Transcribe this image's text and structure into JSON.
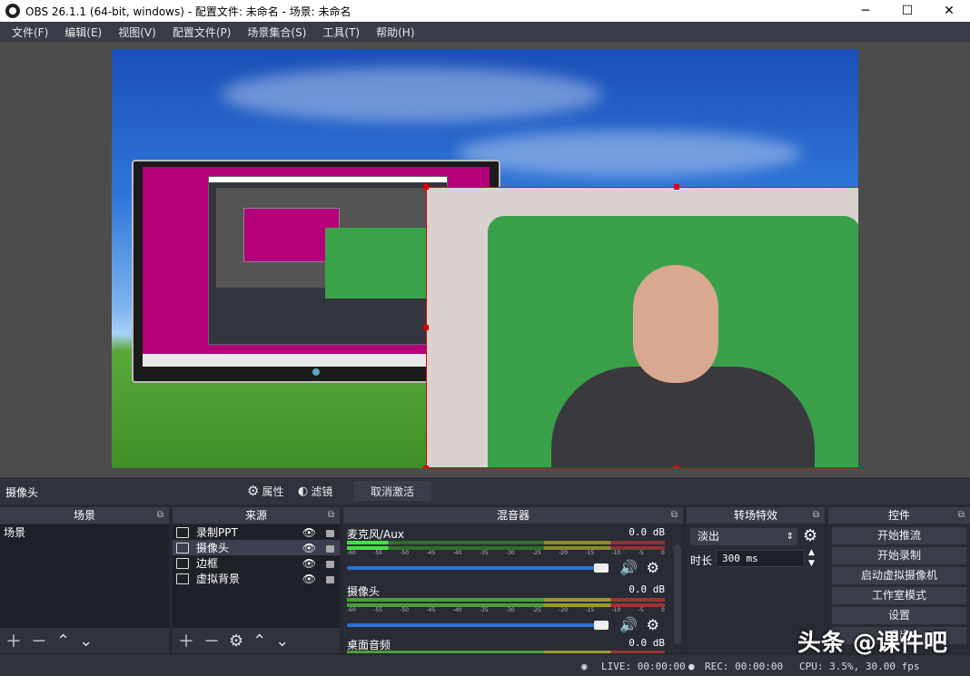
{
  "window": {
    "title": "OBS 26.1.1 (64-bit, windows) - 配置文件: 未命名 - 场景: 未命名",
    "minimize": "─",
    "maximize": "☐",
    "close": "✕"
  },
  "menu": [
    "文件(F)",
    "编辑(E)",
    "视图(V)",
    "配置文件(P)",
    "场景集合(S)",
    "工具(T)",
    "帮助(H)"
  ],
  "source_bar": {
    "selected_source": "摄像头",
    "properties": "属性",
    "filters": "滤镜",
    "deactivate": "取消激活"
  },
  "scenes": {
    "header": "场景",
    "items": [
      "场景"
    ]
  },
  "sources": {
    "header": "来源",
    "items": [
      {
        "name": "录制PPT",
        "icon": "monitor-icon"
      },
      {
        "name": "摄像头",
        "icon": "camera-icon"
      },
      {
        "name": "边框",
        "icon": "image-icon"
      },
      {
        "name": "虚拟背景",
        "icon": "image-icon"
      }
    ]
  },
  "mixer": {
    "header": "混音器",
    "channels": [
      {
        "name": "麦克风/Aux",
        "db": "0.0 dB",
        "level": 0.13
      },
      {
        "name": "摄像头",
        "db": "0.0 dB",
        "level": 0
      },
      {
        "name": "桌面音频",
        "db": "0.0 dB",
        "level": 0
      }
    ],
    "ticks": [
      "-60",
      "-55",
      "-50",
      "-45",
      "-40",
      "-35",
      "-30",
      "-25",
      "-20",
      "-15",
      "-10",
      "-5",
      "0"
    ]
  },
  "transitions": {
    "header": "转场特效",
    "selected": "淡出",
    "duration_label": "时长",
    "duration_value": "300 ms"
  },
  "controls": {
    "header": "控件",
    "buttons": [
      "开始推流",
      "开始录制",
      "启动虚拟摄像机",
      "工作室模式",
      "设置",
      "退出"
    ]
  },
  "status": {
    "live": "LIVE: 00:00:00",
    "rec": "REC: 00:00:00",
    "cpu": "CPU: 3.5%, 30.00 fps"
  },
  "watermark": "头条 @课件吧"
}
